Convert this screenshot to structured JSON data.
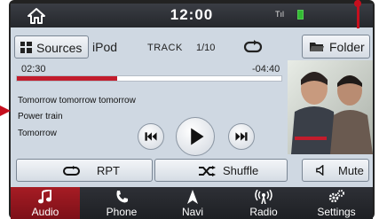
{
  "status": {
    "time": "12:00",
    "signal_text": "Tıl"
  },
  "header": {
    "sources_label": "Sources",
    "source_name": "iPod",
    "track_label": "TRACK",
    "track_counter": "1/10",
    "folder_label": "Folder"
  },
  "playback": {
    "elapsed": "02:30",
    "remaining": "-04:40",
    "progress_fraction": 0.38
  },
  "track": {
    "title": "Tomorrow tomorrow tomorrow",
    "album": "Power train",
    "artist": "Tomorrow"
  },
  "controls": {
    "rpt_label": "RPT",
    "shuffle_label": "Shuffle",
    "mute_label": "Mute"
  },
  "nav": {
    "items": [
      {
        "label": "Audio"
      },
      {
        "label": "Phone"
      },
      {
        "label": "Navi"
      },
      {
        "label": "Radio"
      },
      {
        "label": "Settings"
      }
    ]
  },
  "colors": {
    "accent": "#c21c2c",
    "active_tab": "#a61c24",
    "callout": "#c60f1e"
  }
}
